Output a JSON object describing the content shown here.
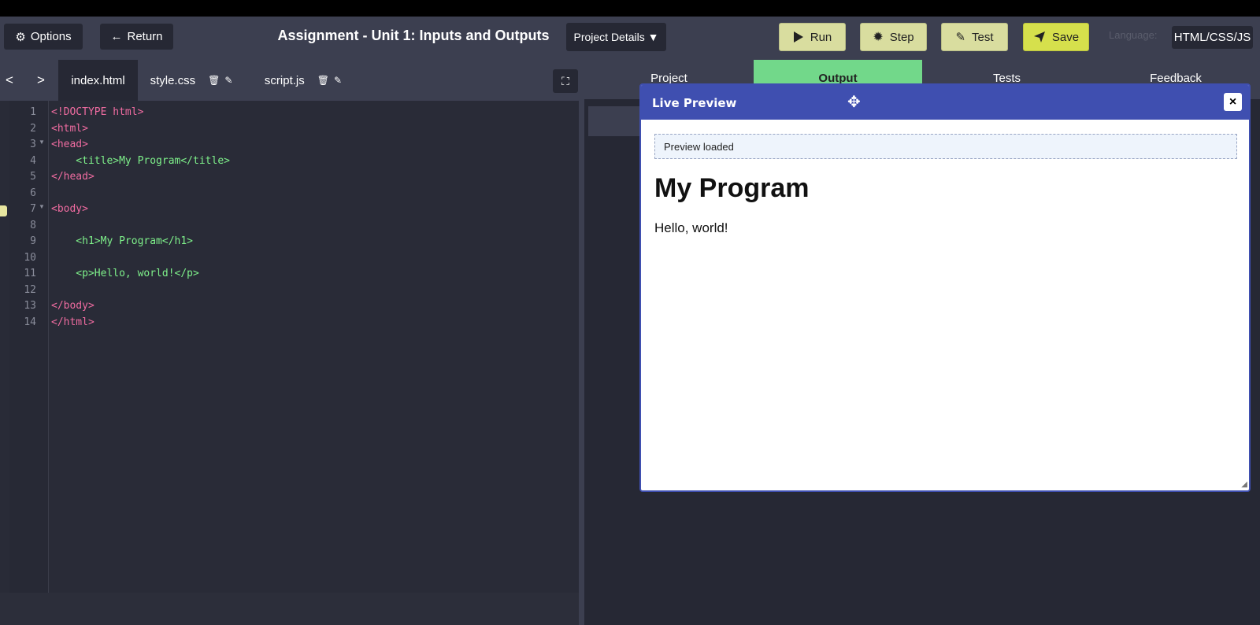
{
  "toolbar": {
    "options_label": "Options",
    "return_label": "Return",
    "title": "Assignment - Unit 1: Inputs and Outputs",
    "project_details_label": "Project Details ▼",
    "run_label": "Run",
    "step_label": "Step",
    "test_label": "Test",
    "save_label": "Save",
    "language_label": "Language:",
    "language_value": "HTML/CSS/JS"
  },
  "file_tabs": {
    "prev": "<",
    "next": ">",
    "files": [
      {
        "name": "index.html"
      },
      {
        "name": "style.css"
      },
      {
        "name": "script.js"
      }
    ]
  },
  "editor": {
    "line_numbers": [
      "1",
      "2",
      "3",
      "4",
      "5",
      "6",
      "7",
      "8",
      "9",
      "10",
      "11",
      "12",
      "13",
      "14"
    ],
    "lines": [
      "<!DOCTYPE html>",
      "<html>",
      "<head>",
      "    <title>My Program</title>",
      "</head>",
      "",
      "<body>",
      "",
      "    <h1>My Program</h1>",
      "",
      "    <p>Hello, world!</p>",
      "",
      "</body>",
      "</html>"
    ]
  },
  "right_tabs": [
    "Project",
    "Output",
    "Tests",
    "Feedback"
  ],
  "preview": {
    "title": "Live Preview",
    "close": "×",
    "status": "Preview loaded",
    "h1": "My Program",
    "p": "Hello, world!"
  },
  "colors": {
    "accent_blue": "#3f4fb0",
    "active_tab_green": "#72d88a",
    "save_yellow": "#d6e04c"
  }
}
